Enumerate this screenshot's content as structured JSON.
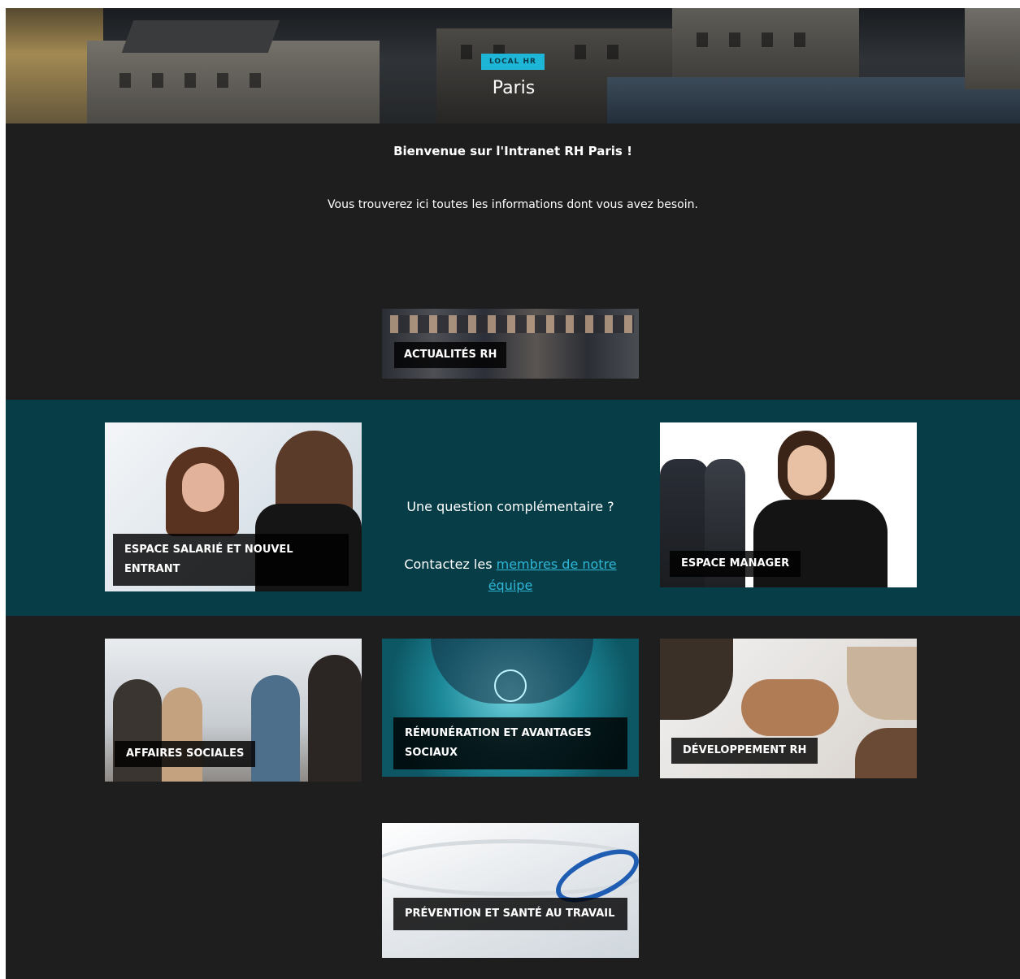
{
  "hero": {
    "badge": "LOCAL HR",
    "title": "Paris"
  },
  "welcome": {
    "heading": "Bienvenue sur l'Intranet RH Paris !",
    "subtitle": "Vous trouverez ici toutes les informations dont vous avez besoin."
  },
  "tiles": {
    "actualites": "ACTUALITÉS RH",
    "salarie": "ESPACE SALARIÉ ET NOUVEL ENTRANT",
    "manager": "ESPACE MANAGER",
    "affaires": "AFFAIRES SOCIALES",
    "remuneration": "RÉMUNÉRATION ET AVANTAGES SOCIAUX",
    "developpement": "DÉVELOPPEMENT RH",
    "prevention": "PRÉVENTION ET SANTÉ AU TRAVAIL"
  },
  "contact": {
    "question": "Une question complémentaire ?",
    "prefix": "Contactez les ",
    "link": "membres de notre équipe"
  },
  "colors": {
    "page_bg": "#1e1e1e",
    "band_bg": "#063d47",
    "badge_bg": "#1eb6d6",
    "link": "#30b7d6"
  }
}
